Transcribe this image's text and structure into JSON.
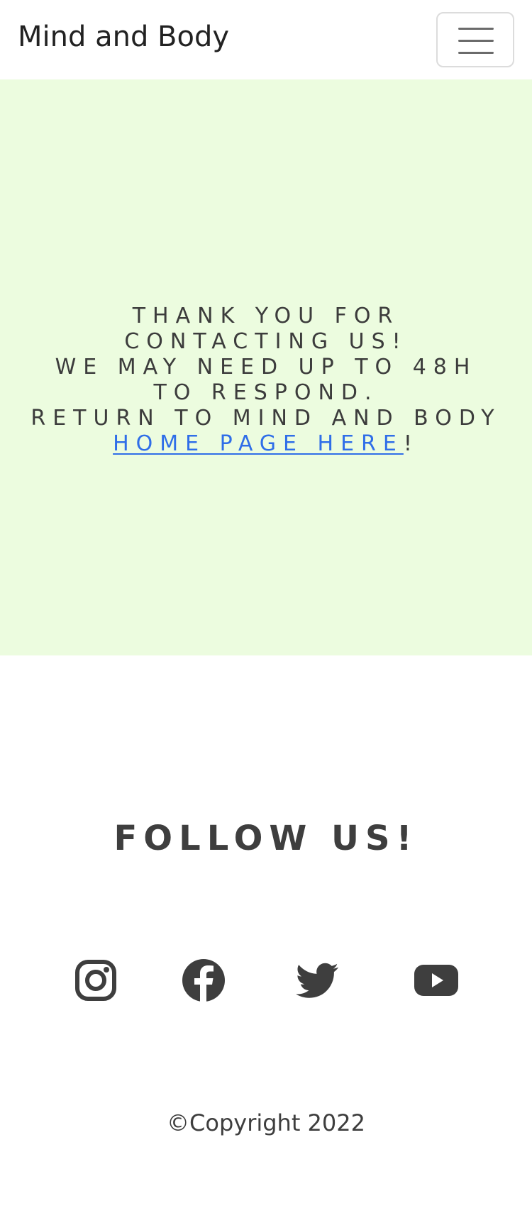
{
  "navbar": {
    "brand": "Mind and Body",
    "toggler_icon": "hamburger-menu-icon"
  },
  "hero": {
    "line1": "Thank you for contacting us!",
    "line2": "We may need up to 48h to respond.",
    "line3_before": "Return to Mind and Body ",
    "link_text": "home page here",
    "line3_after": "!"
  },
  "footer": {
    "follow_title": "Follow us!",
    "social": [
      {
        "icon": "instagram-icon"
      },
      {
        "icon": "facebook-icon"
      },
      {
        "icon": "twitter-icon"
      },
      {
        "icon": "youtube-icon"
      }
    ],
    "copyright": "©Copyright 2022"
  },
  "colors": {
    "hero_background": "#ecfcdf",
    "link": "#2f6ee8",
    "text": "#3c3c3c"
  }
}
